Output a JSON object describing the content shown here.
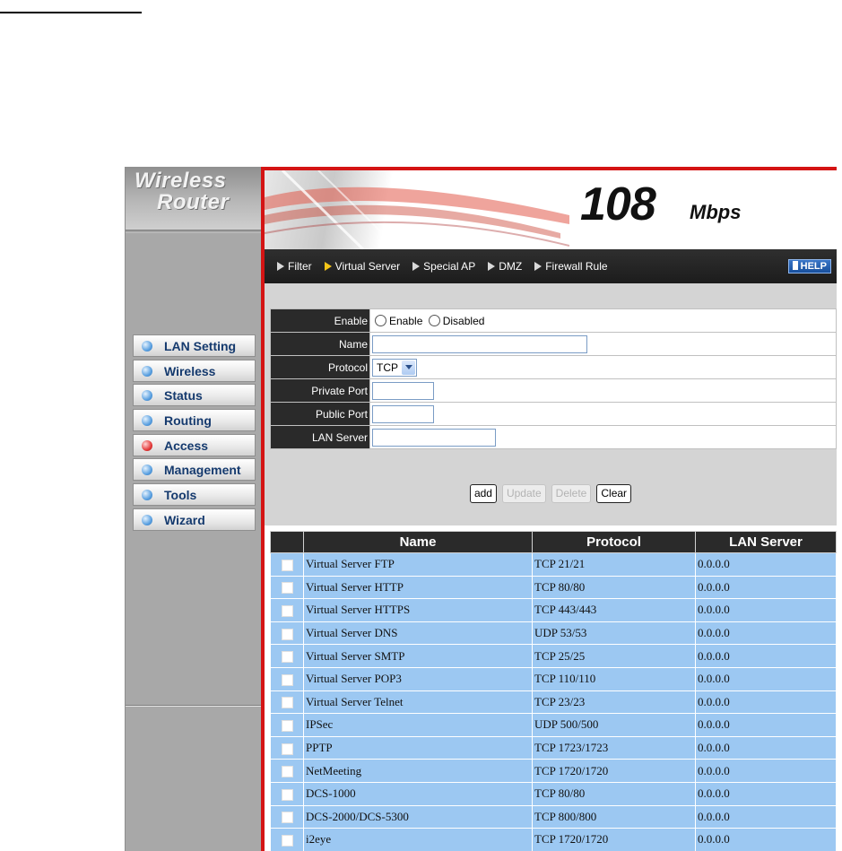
{
  "sidebar": {
    "brand_line1": "Wireless",
    "brand_line2": "Router",
    "items": [
      {
        "label": "LAN Setting",
        "icon": "bullet-icon"
      },
      {
        "label": "Wireless",
        "icon": "bullet-icon"
      },
      {
        "label": "Status",
        "icon": "bullet-icon"
      },
      {
        "label": "Routing",
        "icon": "bullet-icon"
      },
      {
        "label": "Access",
        "icon": "bullet-icon",
        "active": true
      },
      {
        "label": "Management",
        "icon": "bullet-icon"
      },
      {
        "label": "Tools",
        "icon": "bullet-icon"
      },
      {
        "label": "Wizard",
        "icon": "bullet-icon"
      }
    ]
  },
  "banner": {
    "speed": "108",
    "unit": "Mbps"
  },
  "tabs": [
    {
      "label": "Filter"
    },
    {
      "label": "Virtual Server",
      "active": true
    },
    {
      "label": "Special AP"
    },
    {
      "label": "DMZ"
    },
    {
      "label": "Firewall Rule"
    }
  ],
  "help_label": "HELP",
  "form": {
    "enable_label": "Enable",
    "enable_option": "Enable",
    "disable_option": "Disabled",
    "name_label": "Name",
    "name_value": "",
    "protocol_label": "Protocol",
    "protocol_value": "TCP",
    "private_port_label": "Private Port",
    "public_port_label": "Public Port",
    "lan_server_label": "LAN Server"
  },
  "buttons": {
    "add": "add",
    "update": "Update",
    "delete": "Delete",
    "clear": "Clear"
  },
  "table": {
    "columns": [
      "Name",
      "Protocol",
      "LAN Server"
    ],
    "rows": [
      [
        "Virtual Server FTP",
        "TCP 21/21",
        "0.0.0.0"
      ],
      [
        "Virtual Server HTTP",
        "TCP 80/80",
        "0.0.0.0"
      ],
      [
        "Virtual Server HTTPS",
        "TCP 443/443",
        "0.0.0.0"
      ],
      [
        "Virtual Server DNS",
        "UDP 53/53",
        "0.0.0.0"
      ],
      [
        "Virtual Server SMTP",
        "TCP 25/25",
        "0.0.0.0"
      ],
      [
        "Virtual Server POP3",
        "TCP 110/110",
        "0.0.0.0"
      ],
      [
        "Virtual Server Telnet",
        "TCP 23/23",
        "0.0.0.0"
      ],
      [
        "IPSec",
        "UDP 500/500",
        "0.0.0.0"
      ],
      [
        "PPTP",
        "TCP 1723/1723",
        "0.0.0.0"
      ],
      [
        "NetMeeting",
        "TCP 1720/1720",
        "0.0.0.0"
      ],
      [
        "DCS-1000",
        "TCP 80/80",
        "0.0.0.0"
      ],
      [
        "DCS-2000/DCS-5300",
        "TCP 800/800",
        "0.0.0.0"
      ],
      [
        "i2eye",
        "TCP 1720/1720",
        "0.0.0.0"
      ]
    ]
  },
  "colors": {
    "accent_red": "#d41414",
    "row_blue": "#9cc8f2",
    "header_dark": "#2a2a2a"
  }
}
